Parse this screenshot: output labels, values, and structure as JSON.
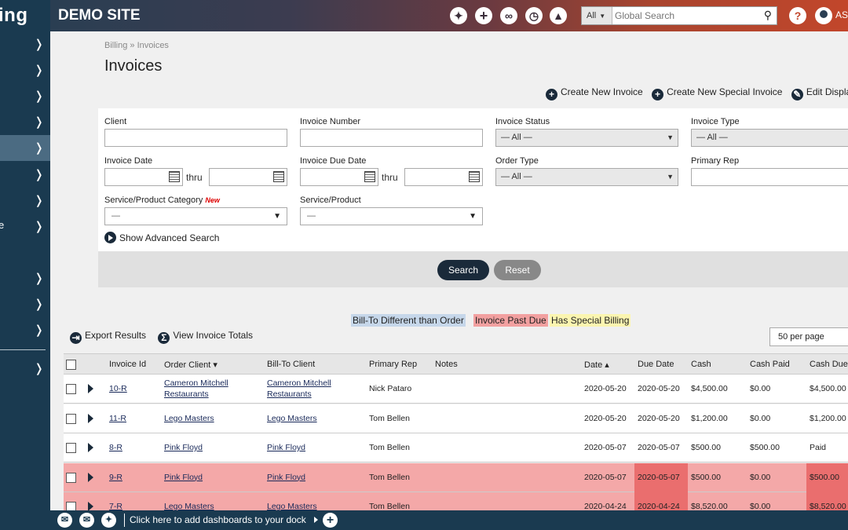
{
  "sidebar": {
    "logo_text": "ing",
    "items": [
      {
        "chevron": "❭"
      },
      {
        "chevron": "❭"
      },
      {
        "chevron": "❭"
      },
      {
        "chevron": "❭"
      },
      {
        "chevron": "❭"
      },
      {
        "chevron": "❭"
      },
      {
        "chevron": "❭"
      },
      {
        "chevron": "❭",
        "label": "e"
      },
      {
        "chevron": "❭"
      },
      {
        "chevron": "❭"
      },
      {
        "chevron": "❭"
      },
      {
        "chevron": "❭"
      }
    ]
  },
  "header": {
    "site_name": "DEMO SITE",
    "search_scope": "All",
    "search_placeholder": "Global Search",
    "help_label": "?",
    "user_label": "AS"
  },
  "breadcrumb": "Billing » Invoices",
  "page_title": "Invoices",
  "actions": {
    "create_invoice": "Create New Invoice",
    "create_special": "Create New Special Invoice",
    "edit_display": "Edit Display"
  },
  "filters": {
    "client_label": "Client",
    "invoice_number_label": "Invoice Number",
    "invoice_status_label": "Invoice Status",
    "invoice_status_value": "— All —",
    "invoice_type_label": "Invoice Type",
    "invoice_type_value": "— All —",
    "invoice_date_label": "Invoice Date",
    "thru": "thru",
    "invoice_due_date_label": "Invoice Due Date",
    "order_type_label": "Order Type",
    "order_type_value": "— All —",
    "primary_rep_label": "Primary Rep",
    "service_category_label": "Service/Product Category",
    "new_badge": "New",
    "service_category_value": "—",
    "service_product_label": "Service/Product",
    "service_product_value": "—",
    "advanced_search": "Show Advanced Search"
  },
  "buttons": {
    "search": "Search",
    "reset": "Reset"
  },
  "legend": {
    "bill_to_different": "Bill-To Different than Order",
    "past_due": "Invoice Past Due",
    "special_billing": "Has Special Billing"
  },
  "tools": {
    "export": "Export Results",
    "totals": "View Invoice Totals",
    "per_page": "50 per page"
  },
  "table": {
    "headers": {
      "invoice_id": "Invoice Id",
      "order_client": "Order Client ▾",
      "bill_to_client": "Bill-To Client",
      "primary_rep": "Primary Rep",
      "notes": "Notes",
      "date": "Date ▴",
      "due_date": "Due Date",
      "cash": "Cash",
      "cash_paid": "Cash Paid",
      "cash_due": "Cash Due"
    },
    "rows": [
      {
        "id": "10-R",
        "order_client_1": "Cameron Mitchell",
        "order_client_2": "Restaurants",
        "bill_to_1": "Cameron Mitchell",
        "bill_to_2": "Restaurants",
        "rep": "Nick Pataro",
        "date": "2020-05-20",
        "due": "2020-05-20",
        "cash": "$4,500.00",
        "paid": "$0.00",
        "cash_due": "$4,500.00",
        "past_due": false
      },
      {
        "id": "11-R",
        "order_client_1": "Lego Masters",
        "order_client_2": "",
        "bill_to_1": "Lego Masters",
        "bill_to_2": "",
        "rep": "Tom Bellen",
        "date": "2020-05-20",
        "due": "2020-05-20",
        "cash": "$1,200.00",
        "paid": "$0.00",
        "cash_due": "$1,200.00",
        "past_due": false
      },
      {
        "id": "8-R",
        "order_client_1": "Pink Floyd",
        "order_client_2": "",
        "bill_to_1": "Pink Floyd",
        "bill_to_2": "",
        "rep": "Tom Bellen",
        "date": "2020-05-07",
        "due": "2020-05-07",
        "cash": "$500.00",
        "paid": "$500.00",
        "cash_due": "Paid",
        "past_due": false
      },
      {
        "id": "9-R",
        "order_client_1": "Pink Floyd",
        "order_client_2": "",
        "bill_to_1": "Pink Floyd",
        "bill_to_2": "",
        "rep": "Tom Bellen",
        "date": "2020-05-07",
        "due": "2020-05-07",
        "cash": "$500.00",
        "paid": "$0.00",
        "cash_due": "$500.00",
        "past_due": true
      },
      {
        "id": "7-R",
        "order_client_1": "Lego Masters",
        "order_client_2": "",
        "bill_to_1": "Lego Masters",
        "bill_to_2": "",
        "rep": "Tom Bellen",
        "date": "2020-04-24",
        "due": "2020-04-24",
        "cash": "$8,520.00",
        "paid": "$0.00",
        "cash_due": "$8,520.00",
        "past_due": true
      }
    ]
  },
  "dock": {
    "text": "Click here to add dashboards to your dock"
  },
  "colors": {
    "sidebar": "#1a3a50",
    "header_start": "#2a3e52",
    "header_end": "#c2462b",
    "past_due": "#f4a8a8",
    "past_due_strong": "#ea6e6e",
    "bill_to_diff": "#c6d7ea",
    "special_billing": "#fbf5b0"
  }
}
